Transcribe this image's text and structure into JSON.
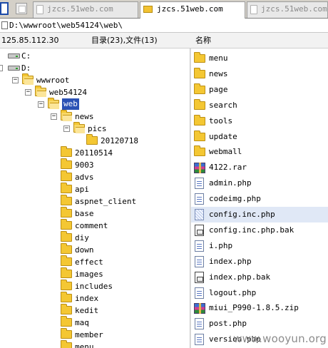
{
  "tabs": [
    {
      "label": "jzcs.51web.com",
      "active": false
    },
    {
      "label": "jzcs.51web.com",
      "active": true
    },
    {
      "label": "jzcs.51web.com",
      "active": false
    }
  ],
  "path": "D:\\wwwroot\\web54124\\web\\",
  "header": {
    "ip": "125.85.112.30",
    "count": "目录(23),文件(13)",
    "name_col": "名称"
  },
  "tree": [
    {
      "label": "C:",
      "type": "drive"
    },
    {
      "label": "D:",
      "type": "drive"
    },
    {
      "label": "wwwroot",
      "type": "folder",
      "expanded": true
    },
    {
      "label": "web54124",
      "type": "folder",
      "expanded": true
    },
    {
      "label": "web",
      "type": "folder",
      "expanded": true,
      "selected": true
    },
    {
      "label": "news",
      "type": "folder",
      "expanded": true
    },
    {
      "label": "pics",
      "type": "folder",
      "expanded": true
    },
    {
      "label": "20120718",
      "type": "folder"
    },
    {
      "label": "20110514",
      "type": "folder"
    },
    {
      "label": "9003",
      "type": "folder"
    },
    {
      "label": "advs",
      "type": "folder"
    },
    {
      "label": "api",
      "type": "folder"
    },
    {
      "label": "aspnet_client",
      "type": "folder"
    },
    {
      "label": "base",
      "type": "folder"
    },
    {
      "label": "comment",
      "type": "folder"
    },
    {
      "label": "diy",
      "type": "folder"
    },
    {
      "label": "down",
      "type": "folder"
    },
    {
      "label": "effect",
      "type": "folder"
    },
    {
      "label": "images",
      "type": "folder"
    },
    {
      "label": "includes",
      "type": "folder"
    },
    {
      "label": "index",
      "type": "folder"
    },
    {
      "label": "kedit",
      "type": "folder"
    },
    {
      "label": "maq",
      "type": "folder"
    },
    {
      "label": "member",
      "type": "folder"
    },
    {
      "label": "menu",
      "type": "folder"
    }
  ],
  "files": [
    {
      "name": "menu",
      "icon": "folder-icon"
    },
    {
      "name": "news",
      "icon": "folder-icon"
    },
    {
      "name": "page",
      "icon": "folder-icon"
    },
    {
      "name": "search",
      "icon": "folder-icon"
    },
    {
      "name": "tools",
      "icon": "folder-icon"
    },
    {
      "name": "update",
      "icon": "folder-icon"
    },
    {
      "name": "webmall",
      "icon": "folder-icon"
    },
    {
      "name": "4122.rar",
      "icon": "rar-icon"
    },
    {
      "name": "admin.php",
      "icon": "file-icon"
    },
    {
      "name": "codeimg.php",
      "icon": "file-icon"
    },
    {
      "name": "config.inc.php",
      "icon": "config-file-icon",
      "selected": true
    },
    {
      "name": "config.inc.php.bak",
      "icon": "bak-file-icon"
    },
    {
      "name": "i.php",
      "icon": "file-icon"
    },
    {
      "name": "index.php",
      "icon": "file-icon"
    },
    {
      "name": "index.php.bak",
      "icon": "bak-file-icon"
    },
    {
      "name": "logout.php",
      "icon": "file-icon"
    },
    {
      "name": "miui_P990-1.8.5.zip",
      "icon": "rar-icon"
    },
    {
      "name": "post.php",
      "icon": "file-icon"
    },
    {
      "name": "version.php",
      "icon": "file-icon"
    }
  ],
  "watermark": "www.wooyun.org",
  "colors": {
    "selection": "#2b51b5",
    "folder": "#f4c733",
    "row_highlight": "#e0e8f6"
  }
}
